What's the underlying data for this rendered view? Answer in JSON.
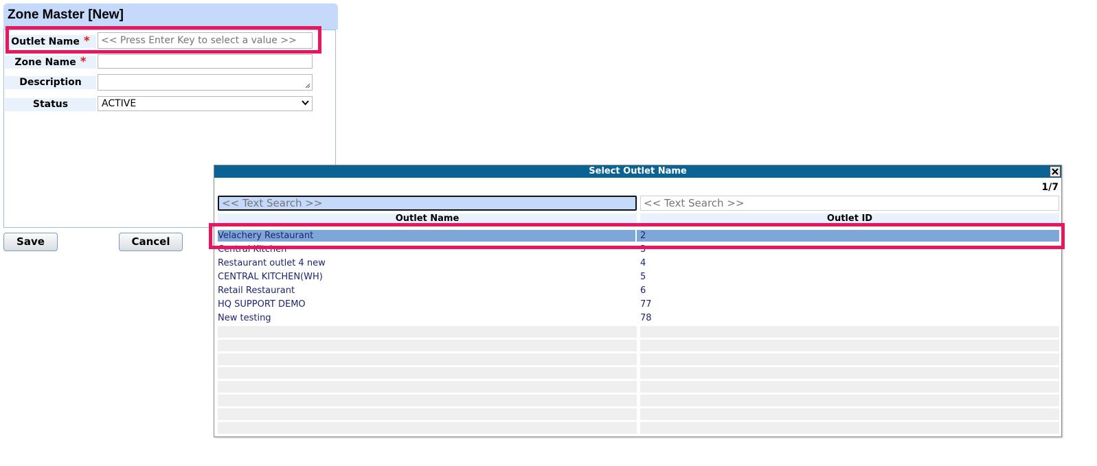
{
  "form": {
    "title": "Zone Master [New]",
    "fields": [
      {
        "label": "Outlet Name",
        "required": "*",
        "value": "",
        "placeholder": "<< Press Enter Key to select a value >>"
      },
      {
        "label": "Zone Name",
        "required": "*",
        "value": ""
      },
      {
        "label": "Description",
        "value": ""
      },
      {
        "label": "Status",
        "value": "ACTIVE"
      }
    ],
    "save_label": "Save",
    "cancel_label": "Cancel"
  },
  "lookup": {
    "title": "Select Outlet Name",
    "counter": "1/7",
    "search_placeholder_1": "<< Text Search >>",
    "search_placeholder_2": "<< Text Search >>",
    "columns": [
      "Outlet Name",
      "Outlet ID"
    ],
    "rows": [
      {
        "name": "Velachery Restaurant",
        "id": "2",
        "selected": true
      },
      {
        "name": "Central Kitchen",
        "id": "3"
      },
      {
        "name": "Restaurant outlet 4 new",
        "id": "4"
      },
      {
        "name": "CENTRAL KITCHEN(WH)",
        "id": "5"
      },
      {
        "name": "Retail Restaurant",
        "id": "6"
      },
      {
        "name": "HQ SUPPORT DEMO",
        "id": "77"
      },
      {
        "name": "New testing",
        "id": "78"
      }
    ]
  },
  "colors": {
    "title_bar": "#0b6394",
    "highlight_border": "#e8175d",
    "selected_row": "#7ea6d8",
    "required_mark": "#e21b1b"
  },
  "icons": {
    "close": "close-icon",
    "status_dropdown": "chevron-down-icon",
    "textarea_resize": "resize-grip-icon"
  }
}
